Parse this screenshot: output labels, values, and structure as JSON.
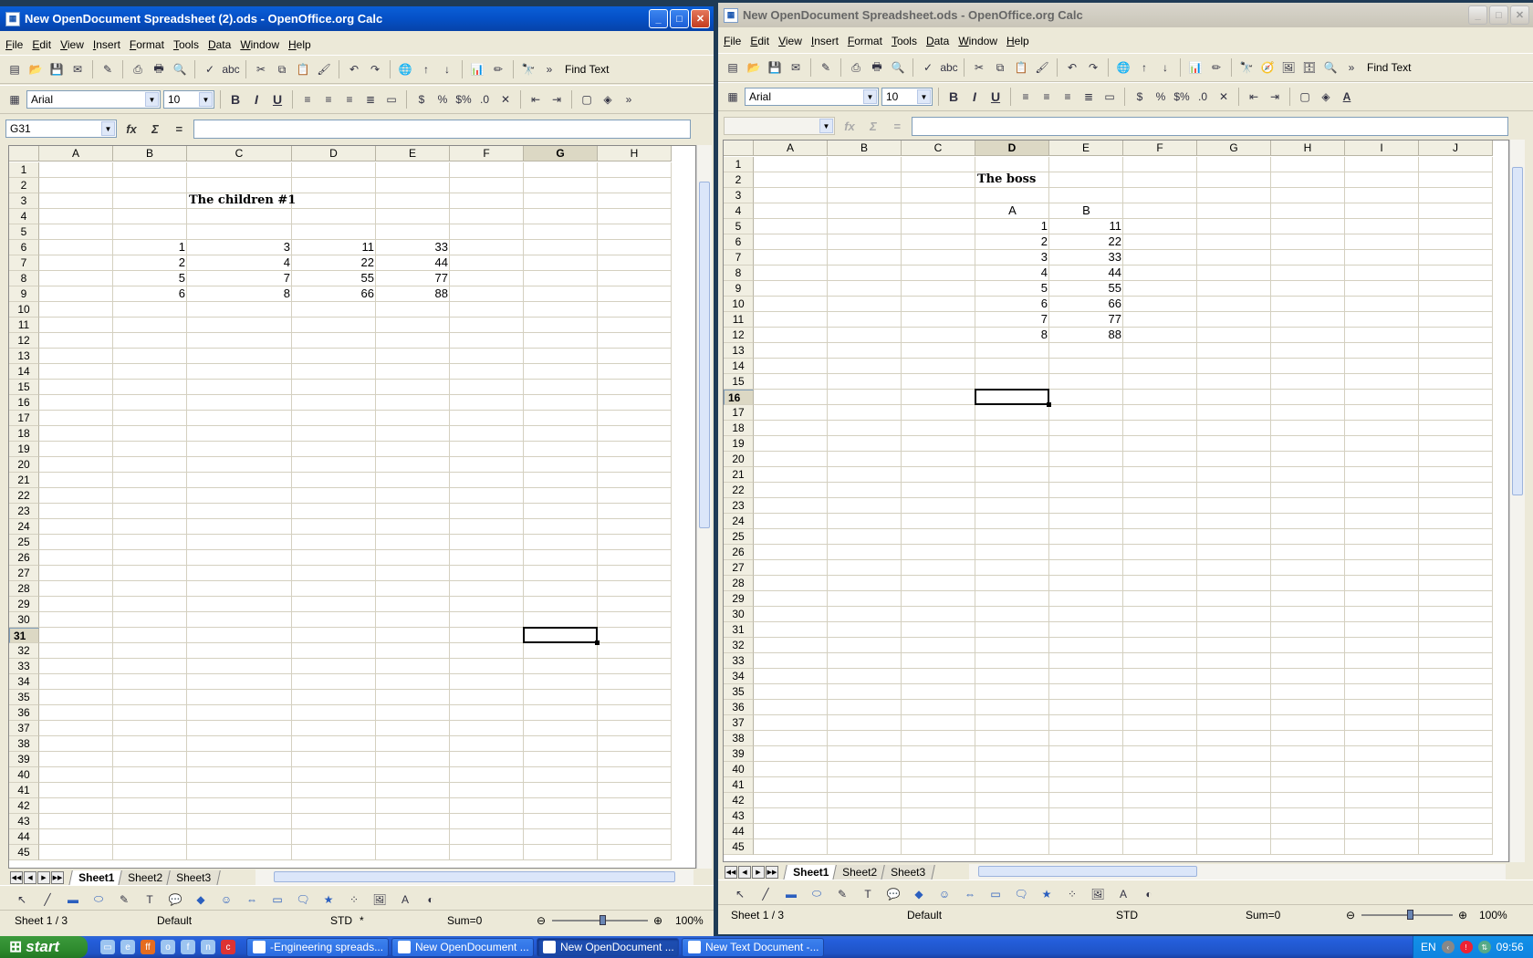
{
  "windows": {
    "left": {
      "title": "New OpenDocument Spreadsheet (2).ods - OpenOffice.org Calc",
      "name_box": "G31",
      "selected_col": "G",
      "selected_row": "31",
      "font_name": "Arial",
      "font_size": "10",
      "find_text": "Find Text",
      "columns": [
        "A",
        "B",
        "C",
        "D",
        "E",
        "F",
        "G",
        "H"
      ],
      "rows": [
        "1",
        "2",
        "3",
        "4",
        "5",
        "6",
        "7",
        "8",
        "9",
        "10",
        "11",
        "12",
        "13",
        "14",
        "15",
        "16",
        "17",
        "18",
        "19",
        "20",
        "21",
        "22",
        "23",
        "24",
        "25",
        "26",
        "27",
        "28",
        "29",
        "30",
        "31",
        "32",
        "33",
        "34",
        "35",
        "36",
        "37",
        "38",
        "39",
        "40",
        "41",
        "42",
        "43",
        "44",
        "45"
      ],
      "cells": {
        "C3": "The children #1",
        "B6": "1",
        "C6": "3",
        "D6": "11",
        "E6": "33",
        "B7": "2",
        "C7": "4",
        "D7": "22",
        "E7": "44",
        "B8": "5",
        "C8": "7",
        "D8": "55",
        "E8": "77",
        "B9": "6",
        "C9": "8",
        "D9": "66",
        "E9": "88"
      },
      "sheet_tabs": [
        "Sheet1",
        "Sheet2",
        "Sheet3"
      ],
      "status": {
        "sheet": "Sheet 1 / 3",
        "style": "Default",
        "mode": "STD",
        "modified": "*",
        "sum": "Sum=0",
        "zoom": "100%"
      }
    },
    "right": {
      "title": "New OpenDocument Spreadsheet.ods - OpenOffice.org Calc",
      "name_box": "",
      "selected_col": "D",
      "selected_row": "16",
      "font_name": "Arial",
      "font_size": "10",
      "find_text": "Find Text",
      "columns": [
        "A",
        "B",
        "C",
        "D",
        "E",
        "F",
        "G",
        "H",
        "I",
        "J"
      ],
      "rows": [
        "1",
        "2",
        "3",
        "4",
        "5",
        "6",
        "7",
        "8",
        "9",
        "10",
        "11",
        "12",
        "13",
        "14",
        "15",
        "16",
        "17",
        "18",
        "19",
        "20",
        "21",
        "22",
        "23",
        "24",
        "25",
        "26",
        "27",
        "28",
        "29",
        "30",
        "31",
        "32",
        "33",
        "34",
        "35",
        "36",
        "37",
        "38",
        "39",
        "40",
        "41",
        "42",
        "43",
        "44",
        "45"
      ],
      "cells": {
        "D2": "The boss",
        "D4": "A",
        "E4": "B",
        "D5": "1",
        "E5": "11",
        "D6": "2",
        "E6": "22",
        "D7": "3",
        "E7": "33",
        "D8": "4",
        "E8": "44",
        "D9": "5",
        "E9": "55",
        "D10": "6",
        "E10": "66",
        "D11": "7",
        "E11": "77",
        "D12": "8",
        "E12": "88"
      },
      "sheet_tabs": [
        "Sheet1",
        "Sheet2",
        "Sheet3"
      ],
      "status": {
        "sheet": "Sheet 1 / 3",
        "style": "Default",
        "mode": "STD",
        "modified": "",
        "sum": "Sum=0",
        "zoom": "100%"
      }
    }
  },
  "menu": [
    "File",
    "Edit",
    "View",
    "Insert",
    "Format",
    "Tools",
    "Data",
    "Window",
    "Help"
  ],
  "taskbar": {
    "start_label": "start",
    "tasks": [
      {
        "label": "-Engineering spreads...",
        "active": false
      },
      {
        "label": "New OpenDocument ...",
        "active": false
      },
      {
        "label": "New OpenDocument ...",
        "active": true
      },
      {
        "label": "New Text Document -...",
        "active": false
      }
    ],
    "lang": "EN",
    "clock": "09:56"
  },
  "colors": {
    "title_active": "#0550c6",
    "desktop": "#1f3b56",
    "taskbar": "#245edb"
  }
}
